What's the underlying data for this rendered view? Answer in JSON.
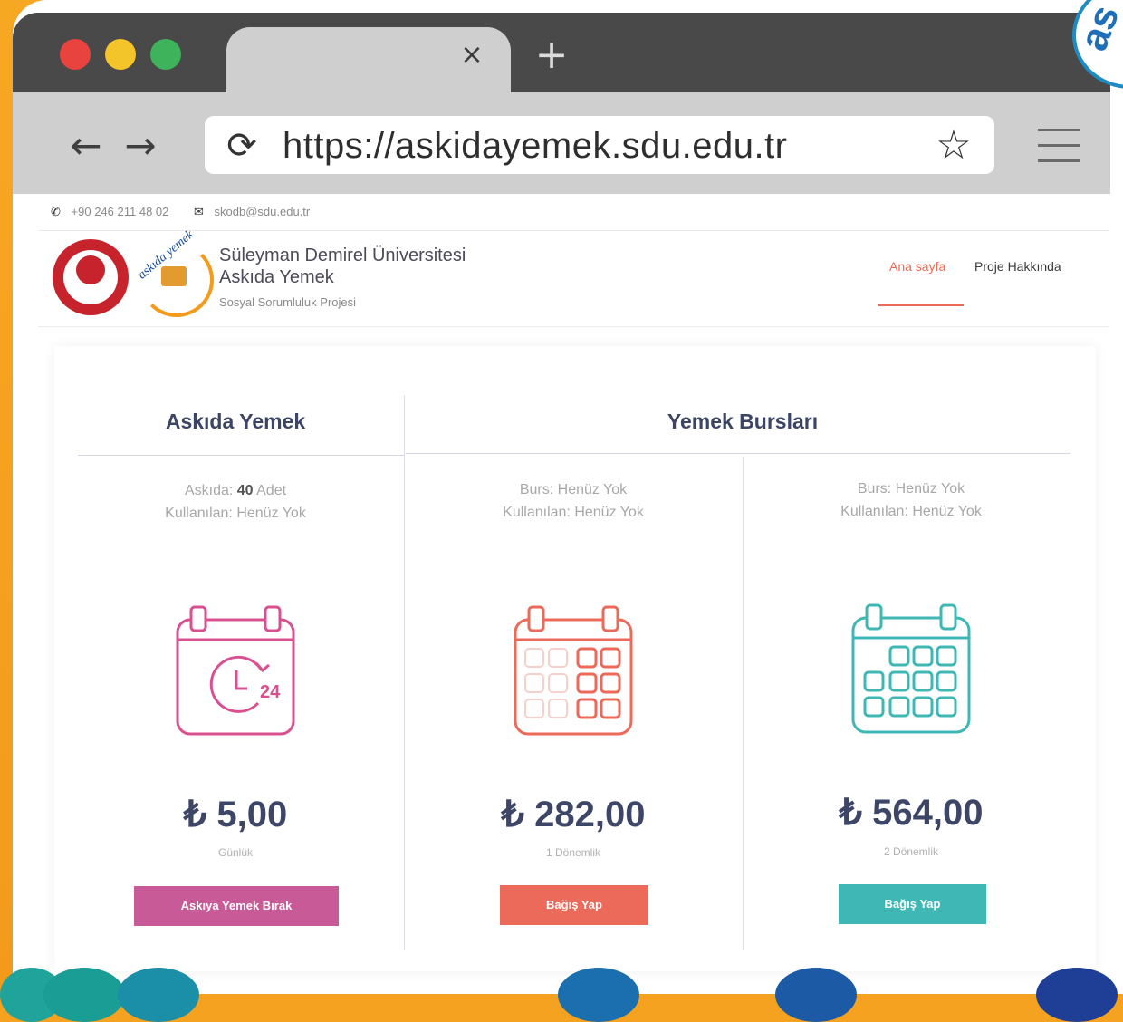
{
  "browser": {
    "tab_close": "×",
    "new_tab": "+",
    "back": "←",
    "forward": "→",
    "reload": "⟳",
    "url": "https://askidayemek.sdu.edu.tr",
    "bookmark": "☆"
  },
  "brand_corner": "as",
  "topbar": {
    "phone": "+90 246 211 48 02",
    "email": "skodb@sdu.edu.tr"
  },
  "site": {
    "title_line1": "Süleyman Demirel Üniversitesi",
    "title_line2": "Askıda Yemek",
    "subtitle": "Sosyal Sorumluluk Projesi",
    "logo_word": "askıda yemek"
  },
  "nav": {
    "home": "Ana sayfa",
    "about": "Proje Hakkında"
  },
  "sections": {
    "left_title": "Askıda Yemek",
    "right_title": "Yemek Bursları"
  },
  "cards": [
    {
      "line1_prefix": "Askıda:",
      "line1_value": "40",
      "line1_suffix": "Adet",
      "line2": "Kullanılan: Henüz Yok",
      "price": "₺ 5,00",
      "period": "Günlük",
      "button": "Askıya Yemek Bırak",
      "color": "#c95a98",
      "icon": "calendar-24h-icon"
    },
    {
      "line1": "Burs: Henüz Yok",
      "line2": "Kullanılan: Henüz Yok",
      "price": "₺ 282,00",
      "period": "1 Dönemlik",
      "button": "Bağış Yap",
      "color": "#ec6a5a",
      "icon": "calendar-grid-icon"
    },
    {
      "line1": "Burs: Henüz Yok",
      "line2": "Kullanılan: Henüz Yok",
      "price": "₺ 564,00",
      "period": "2 Dönemlik",
      "button": "Bağış Yap",
      "color": "#3fb8b5",
      "icon": "calendar-grid-icon"
    }
  ],
  "icon_text": "24",
  "colors": {
    "accent_home": "#ec6a55",
    "title_text": "#3c4564",
    "background": "#f4a21f"
  }
}
